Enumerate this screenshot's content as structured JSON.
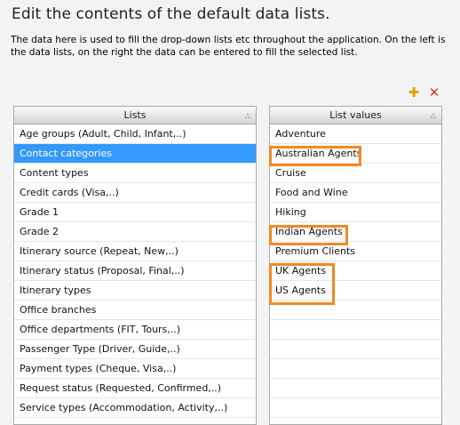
{
  "page": {
    "title": "Edit the contents of the default data lists.",
    "description": "The data here is used to fill the drop-down lists etc throughout the application. On the left is the data lists, on the right the data can be entered to fill the selected list."
  },
  "toolbar": {
    "add_icon": "plus-icon",
    "delete_icon": "close-icon",
    "add_color": "#e0a000",
    "delete_color": "#dd3333"
  },
  "lists": {
    "header": "Lists",
    "selected_index": 1,
    "items": [
      "Age groups (Adult, Child, Infant,..)",
      "Contact categories",
      "Content types",
      "Credit cards (Visa,..)",
      "Grade 1",
      "Grade 2",
      "Itinerary source (Repeat, New,..)",
      "Itinerary status (Proposal, Final,..)",
      "Itinerary types",
      "Office branches",
      "Office departments (FIT, Tours,..)",
      "Passenger Type (Driver, Guide,..)",
      "Payment types (Cheque, Visa,..)",
      "Request status (Requested, Confirmed,..)",
      "Service types (Accommodation, Activity,..)"
    ]
  },
  "list_values": {
    "header": "List values",
    "items": [
      "Adventure",
      "Australian Agents",
      "Cruise",
      "Food and Wine",
      "Hiking",
      "Indian Agents",
      "Premium Clients",
      "UK Agents",
      "US Agents",
      "",
      "",
      "",
      "",
      "",
      ""
    ]
  },
  "colors": {
    "selection": "#3399ff",
    "highlight_outline": "#f08a24"
  }
}
